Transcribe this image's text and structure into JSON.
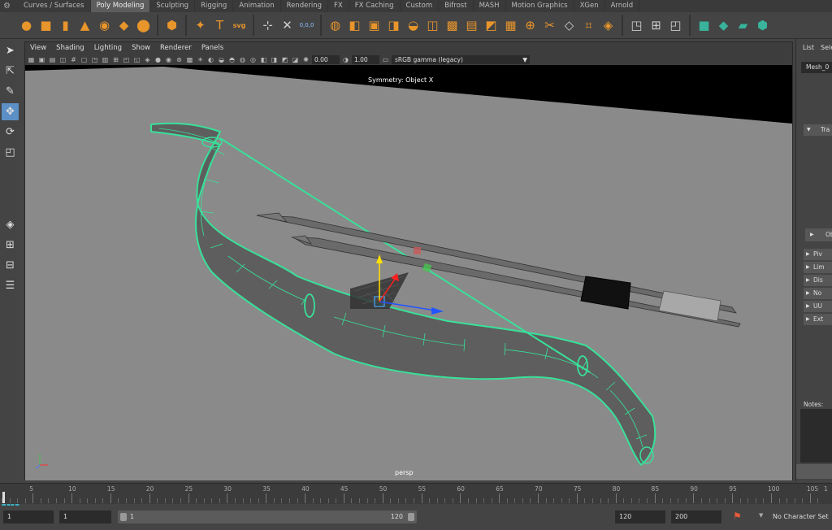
{
  "shelf_tabs": [
    "Curves / Surfaces",
    "Poly Modeling",
    "Sculpting",
    "Rigging",
    "Animation",
    "Rendering",
    "FX",
    "FX Caching",
    "Custom",
    "Bifrost",
    "MASH",
    "Motion Graphics",
    "XGen",
    "Arnold"
  ],
  "active_tab": "Poly Modeling",
  "shelf_icons": [
    "sphere-icon",
    "cube-icon",
    "cylinder-icon",
    "cone-icon",
    "torus-icon",
    "plane-icon",
    "disc-icon",
    "platonic-icon",
    "sweep-icon",
    "text-icon",
    "svg-icon",
    "super-shape-icon",
    "center-pivot-icon",
    "freeze-icon",
    "combine-icon",
    "separate-icon",
    "smooth-icon",
    "extract-icon",
    "boolean-icon",
    "mirror-icon",
    "extrude-icon",
    "bridge-icon",
    "bevel-icon",
    "fill-hole-icon",
    "append-icon",
    "multi-cut-icon",
    "target-weld-icon",
    "connect-icon",
    "collapse-icon",
    "uv-planar-icon",
    "uv-auto-icon",
    "uv-editor-icon"
  ],
  "shelf_text": {
    "text_label": "T",
    "svg_label": "svg",
    "coord_label": "0,0,0"
  },
  "panel_menu": [
    "View",
    "Shading",
    "Lighting",
    "Show",
    "Renderer",
    "Panels"
  ],
  "panel_toolbar": {
    "field1": "0.00",
    "field2": "1.00",
    "color_space": "sRGB gamma (legacy)"
  },
  "viewport": {
    "symmetry_label": "Symmetry: Object X",
    "camera_label": "persp",
    "wire_color": "#39e09a",
    "background_color": "#8a8a8a"
  },
  "right_panel": {
    "tabs": [
      "List",
      "Sele"
    ],
    "mesh_name": "Mesh_0",
    "section_top": "Tra",
    "section_obj": "Ob",
    "rows": [
      "Piv",
      "Lim",
      "Dis",
      "No",
      "UU",
      "Ext"
    ],
    "notes_label": "Notes:"
  },
  "timeline": {
    "ticks": [
      5,
      10,
      15,
      20,
      25,
      30,
      35,
      40,
      45,
      50,
      55,
      60,
      65,
      70,
      75,
      80,
      85,
      90,
      95,
      100,
      105
    ],
    "last_tick": "1"
  },
  "range": {
    "start_field": "1",
    "playback_start": "1",
    "slider_start": "1",
    "slider_end": "120",
    "end_field": "120",
    "anim_end": "200",
    "character_set": "No Character Set"
  }
}
